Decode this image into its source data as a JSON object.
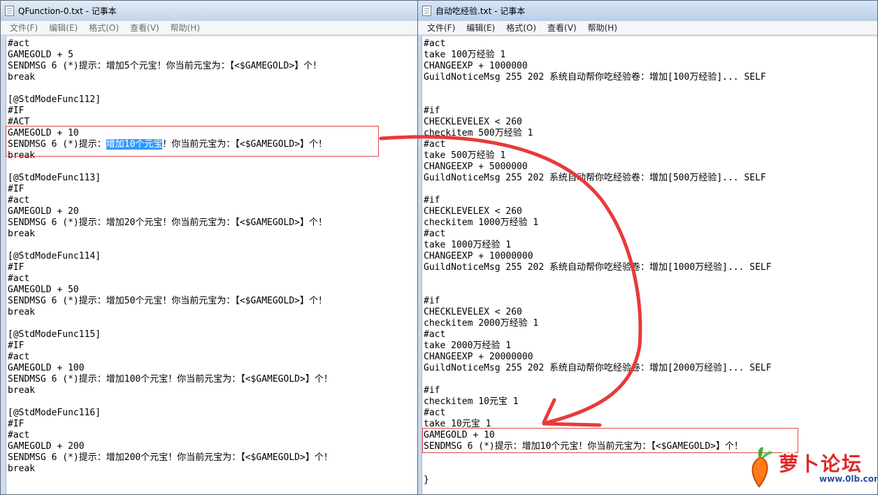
{
  "left_window": {
    "title": "QFunction-0.txt - 记事本",
    "menu": [
      "文件(F)",
      "编辑(E)",
      "格式(O)",
      "查看(V)",
      "帮助(H)"
    ],
    "lines": [
      "#act",
      "GAMEGOLD + 5",
      "SENDMSG 6 (*)提示：增加5个元宝！你当前元宝为：【<$GAMEGOLD>】个！",
      "break",
      "",
      "[@StdModeFunc112]",
      "#IF",
      "#ACT",
      "GAMEGOLD + 10",
      "__SEL__",
      "break",
      "",
      "[@StdModeFunc113]",
      "#IF",
      "#act",
      "GAMEGOLD + 20",
      "SENDMSG 6 (*)提示：增加20个元宝！你当前元宝为：【<$GAMEGOLD>】个！",
      "break",
      "",
      "[@StdModeFunc114]",
      "#IF",
      "#act",
      "GAMEGOLD + 50",
      "SENDMSG 6 (*)提示：增加50个元宝！你当前元宝为：【<$GAMEGOLD>】个！",
      "break",
      "",
      "[@StdModeFunc115]",
      "#IF",
      "#act",
      "GAMEGOLD + 100",
      "SENDMSG 6 (*)提示：增加100个元宝！你当前元宝为：【<$GAMEGOLD>】个！",
      "break",
      "",
      "[@StdModeFunc116]",
      "#IF",
      "#act",
      "GAMEGOLD + 200",
      "SENDMSG 6 (*)提示：增加200个元宝！你当前元宝为：【<$GAMEGOLD>】个！",
      "break"
    ],
    "selected_line": {
      "before": "SENDMSG 6 (*)提示：",
      "selected": "增加10个元宝",
      "after": "！你当前元宝为：【<$GAMEGOLD>】个！"
    }
  },
  "right_window": {
    "title": "自动吃经验.txt - 记事本",
    "menu": [
      "文件(F)",
      "编辑(E)",
      "格式(O)",
      "查看(V)",
      "帮助(H)"
    ],
    "lines": [
      "#act",
      "take 100万经验 1",
      "CHANGEEXP + 1000000",
      "GuildNoticeMsg 255 202 系统自动帮你吃经验卷：增加[100万经验]... SELF",
      "",
      "",
      "#if",
      "CHECKLEVELEX < 260",
      "checkitem 500万经验 1",
      "#act",
      "take 500万经验 1",
      "CHANGEEXP + 5000000",
      "GuildNoticeMsg 255 202 系统自动帮你吃经验卷：增加[500万经验]... SELF",
      "",
      "#if",
      "CHECKLEVELEX < 260",
      "checkitem 1000万经验 1",
      "#act",
      "take 1000万经验 1",
      "CHANGEEXP + 10000000",
      "GuildNoticeMsg 255 202 系统自动帮你吃经验卷：增加[1000万经验]... SELF",
      "",
      "",
      "#if",
      "CHECKLEVELEX < 260",
      "checkitem 2000万经验 1",
      "#act",
      "take 2000万经验 1",
      "CHANGEEXP + 20000000",
      "GuildNoticeMsg 255 202 系统自动帮你吃经验卷：增加[2000万经验]... SELF",
      "",
      "#if",
      "checkitem 10元宝 1",
      "#act",
      "take 10元宝 1",
      "GAMEGOLD + 10",
      "SENDMSG 6 (*)提示：增加10个元宝！你当前元宝为：【<$GAMEGOLD>】个！",
      "",
      "",
      "}"
    ]
  },
  "watermark": {
    "text": "萝卜论坛",
    "sub": "www.0lb.com"
  },
  "colors": {
    "annotation_red": "#e83a3a",
    "selection_blue": "#3399ff"
  }
}
